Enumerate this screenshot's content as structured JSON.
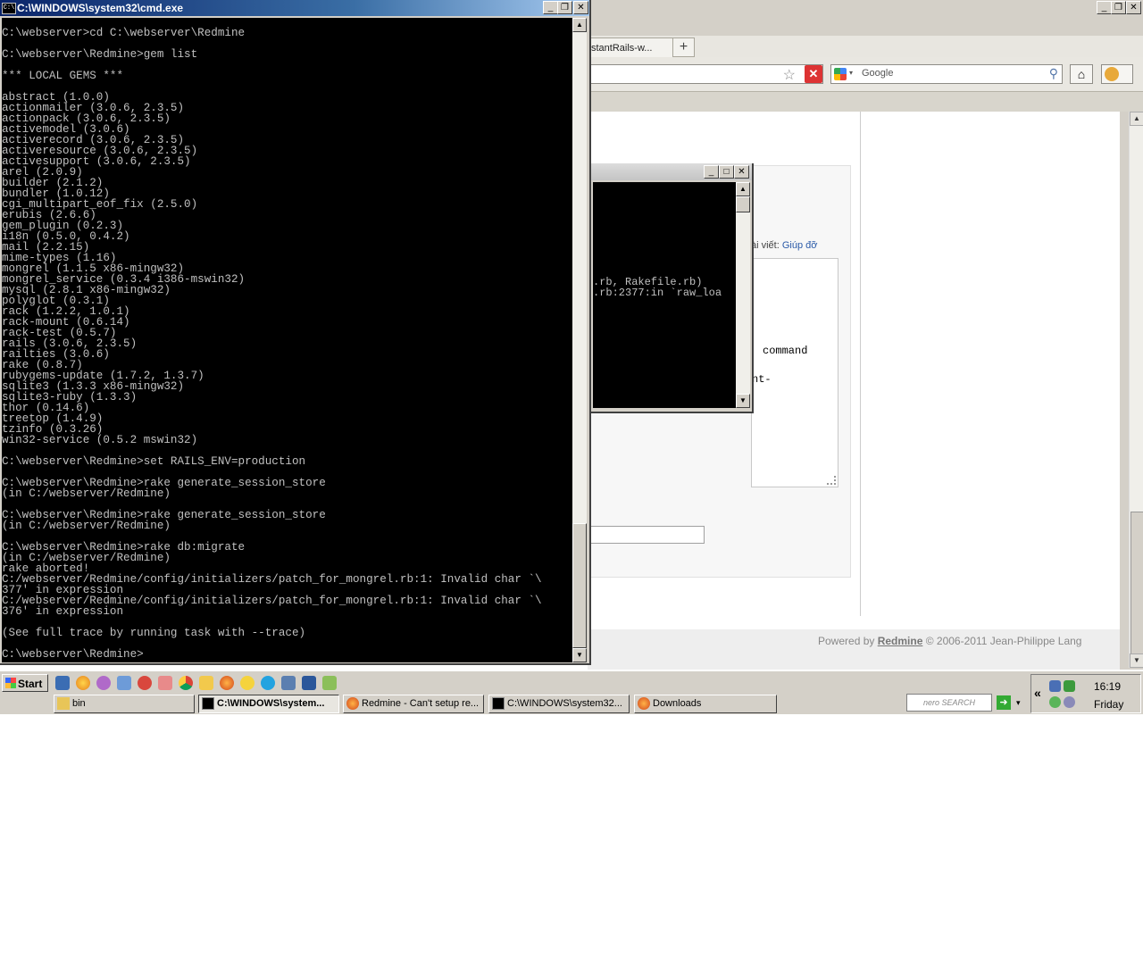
{
  "browser": {
    "tab_label": "stantRails-w...",
    "tab_close": "×",
    "new_tab": "+",
    "search_placeholder": "Google",
    "hint_text": "ài viết: ",
    "hint_link": "Giúp đỡ",
    "textarea_line1": "command",
    "textarea_line2": "nt-",
    "footer_prefix": "Powered by ",
    "footer_link": "Redmine",
    "footer_suffix": " © 2006-2011 Jean-Philippe Lang"
  },
  "mini_cmd": {
    "line1": ".rb, Rakefile.rb)",
    "line2": ".rb:2377:in `raw_loa"
  },
  "cmd": {
    "title": "C:\\WINDOWS\\system32\\cmd.exe",
    "icon_text": "C:\\",
    "output": "C:\\webserver>cd C:\\webserver\\Redmine\n\nC:\\webserver\\Redmine>gem list\n\n*** LOCAL GEMS ***\n\nabstract (1.0.0)\nactionmailer (3.0.6, 2.3.5)\nactionpack (3.0.6, 2.3.5)\nactivemodel (3.0.6)\nactiverecord (3.0.6, 2.3.5)\nactiveresource (3.0.6, 2.3.5)\nactivesupport (3.0.6, 2.3.5)\narel (2.0.9)\nbuilder (2.1.2)\nbundler (1.0.12)\ncgi_multipart_eof_fix (2.5.0)\nerubis (2.6.6)\ngem_plugin (0.2.3)\ni18n (0.5.0, 0.4.2)\nmail (2.2.15)\nmime-types (1.16)\nmongrel (1.1.5 x86-mingw32)\nmongrel_service (0.3.4 i386-mswin32)\nmysql (2.8.1 x86-mingw32)\npolyglot (0.3.1)\nrack (1.2.2, 1.0.1)\nrack-mount (0.6.14)\nrack-test (0.5.7)\nrails (3.0.6, 2.3.5)\nrailties (3.0.6)\nrake (0.8.7)\nrubygems-update (1.7.2, 1.3.7)\nsqlite3 (1.3.3 x86-mingw32)\nsqlite3-ruby (1.3.3)\nthor (0.14.6)\ntreetop (1.4.9)\ntzinfo (0.3.26)\nwin32-service (0.5.2 mswin32)\n\nC:\\webserver\\Redmine>set RAILS_ENV=production\n\nC:\\webserver\\Redmine>rake generate_session_store\n(in C:/webserver/Redmine)\n\nC:\\webserver\\Redmine>rake generate_session_store\n(in C:/webserver/Redmine)\n\nC:\\webserver\\Redmine>rake db:migrate\n(in C:/webserver/Redmine)\nrake aborted!\nC:/webserver/Redmine/config/initializers/patch_for_mongrel.rb:1: Invalid char `\\\n377' in expression\nC:/webserver/Redmine/config/initializers/patch_for_mongrel.rb:1: Invalid char `\\\n376' in expression\n\n(See full trace by running task with --trace)\n\nC:\\webserver\\Redmine>"
  },
  "taskbar": {
    "start_label": "Start",
    "tasks": [
      {
        "label": "bin",
        "icon": "folder-icon"
      },
      {
        "label": "C:\\WINDOWS\\system...",
        "icon": "cmd-icon"
      },
      {
        "label": "Redmine - Can't setup re...",
        "icon": "firefox-icon"
      },
      {
        "label": "C:\\WINDOWS\\system32...",
        "icon": "cmd-icon"
      },
      {
        "label": "Downloads",
        "icon": "firefox-icon"
      }
    ],
    "nero_label": "nero SEARCH",
    "time": "16:19",
    "day": "Friday"
  },
  "colors": {
    "title_active": "#0a246a",
    "terminal_bg": "#000000",
    "terminal_fg": "#c0c0c0",
    "link": "#2a5aa8"
  }
}
